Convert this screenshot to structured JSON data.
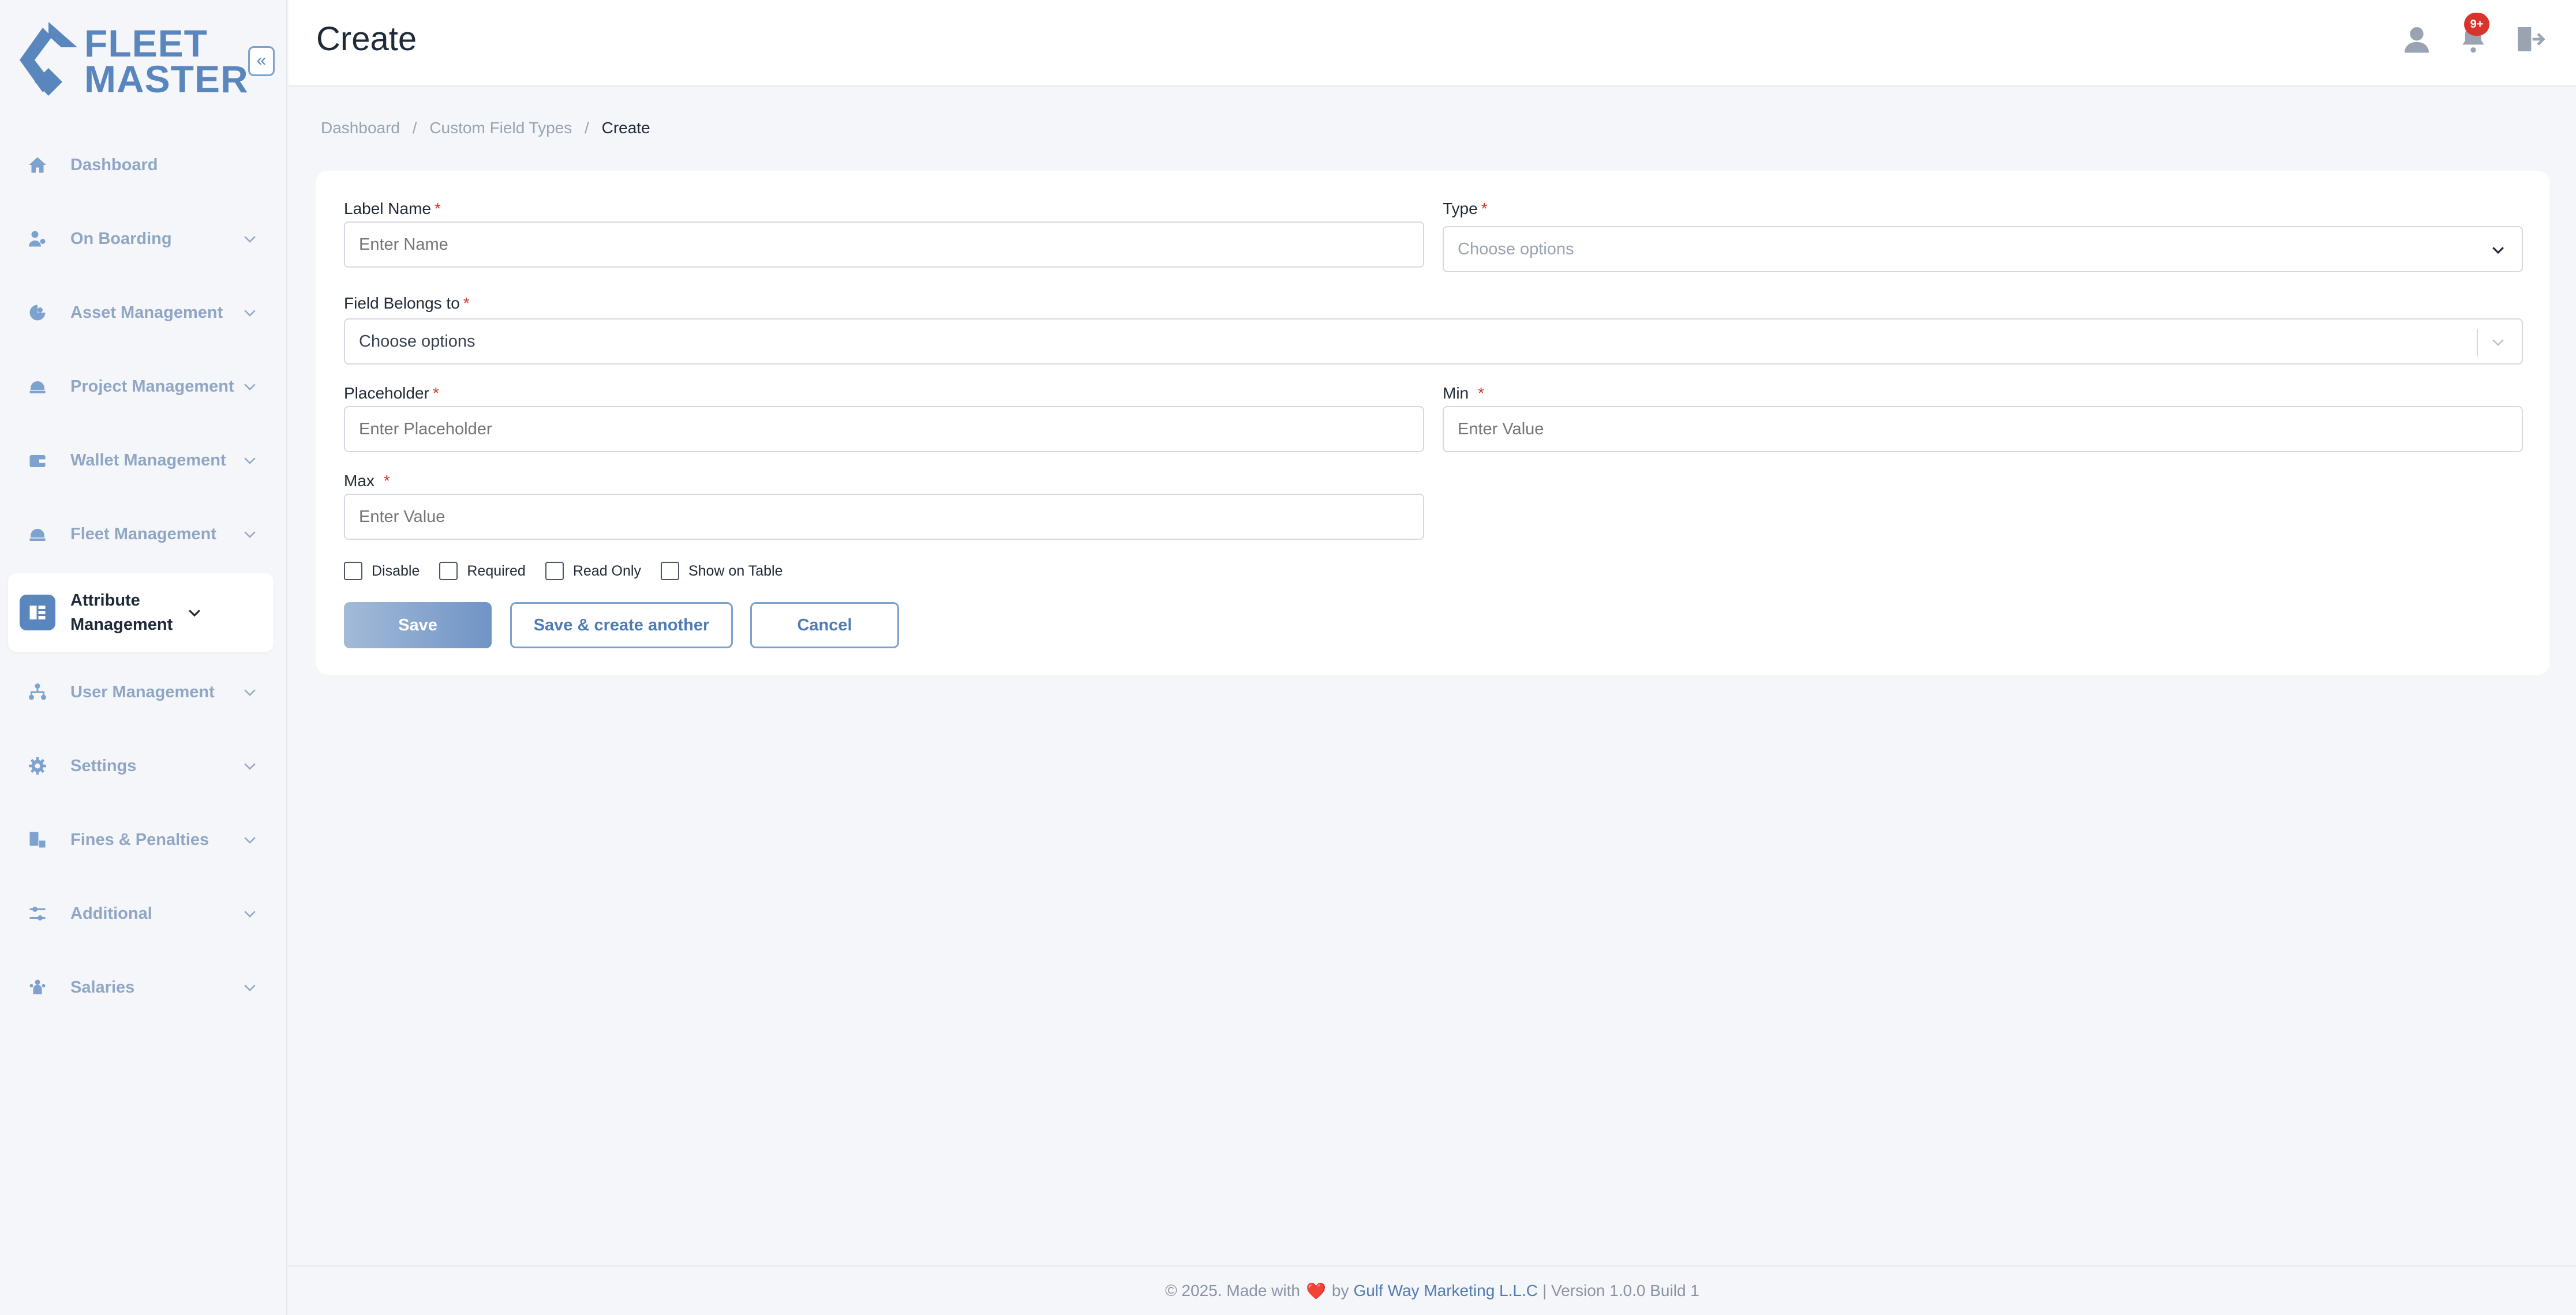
{
  "app": {
    "logo_line1": "FLEET",
    "logo_line2": "MASTER",
    "collapse_glyph": "«"
  },
  "colors": {
    "accent": "#5a86be",
    "danger": "#d9342b",
    "sidebar_text": "#8fa6c4"
  },
  "sidebar": {
    "items": [
      {
        "label": "Dashboard",
        "icon": "home-icon",
        "has_chevron": false
      },
      {
        "label": "On Boarding",
        "icon": "user-onboard-icon",
        "has_chevron": true
      },
      {
        "label": "Asset Management",
        "icon": "gauge-icon",
        "has_chevron": true
      },
      {
        "label": "Project Management",
        "icon": "hardhat-icon",
        "has_chevron": true
      },
      {
        "label": "Wallet Management",
        "icon": "wallet-icon",
        "has_chevron": true
      },
      {
        "label": "Fleet Management",
        "icon": "hardhat-icon",
        "has_chevron": true
      },
      {
        "label": "Attribute Management",
        "icon": "attribute-icon",
        "has_chevron": true,
        "active": true
      },
      {
        "label": "User Management",
        "icon": "org-chart-icon",
        "has_chevron": true
      },
      {
        "label": "Settings",
        "icon": "gear-icon",
        "has_chevron": true
      },
      {
        "label": "Fines & Penalties",
        "icon": "fines-icon",
        "has_chevron": true
      },
      {
        "label": "Additional",
        "icon": "sliders-icon",
        "has_chevron": true
      },
      {
        "label": "Salaries",
        "icon": "people-icon",
        "has_chevron": true
      }
    ]
  },
  "header": {
    "title": "Create",
    "notification_badge": "9+"
  },
  "breadcrumb": {
    "items": [
      "Dashboard",
      "Custom Field Types",
      "Create"
    ],
    "separator": "/"
  },
  "form": {
    "label_name": {
      "label": "Label Name",
      "required": "*",
      "placeholder": "Enter Name"
    },
    "type": {
      "label": "Type",
      "required": "*",
      "value": "Choose options"
    },
    "field_belongs_to": {
      "label": "Field Belongs to",
      "required": "*",
      "value": "Choose options"
    },
    "placeholder": {
      "label": "Placeholder",
      "required": "*",
      "placeholder": "Enter Placeholder"
    },
    "min": {
      "label": "Min",
      "required": "*",
      "placeholder": "Enter Value"
    },
    "max": {
      "label": "Max",
      "required": "*",
      "placeholder": "Enter Value"
    },
    "checkboxes": [
      {
        "label": "Disable",
        "checked": false
      },
      {
        "label": "Required",
        "checked": false
      },
      {
        "label": "Read Only",
        "checked": false
      },
      {
        "label": "Show on Table",
        "checked": false
      }
    ],
    "buttons": {
      "save": "Save",
      "save_another": "Save & create another",
      "cancel": "Cancel"
    }
  },
  "footer": {
    "prefix": "© 2025. Made with",
    "heart": "❤️",
    "by": "by",
    "company": "Gulf Way Marketing L.L.C",
    "suffix": "| Version 1.0.0 Build 1"
  }
}
